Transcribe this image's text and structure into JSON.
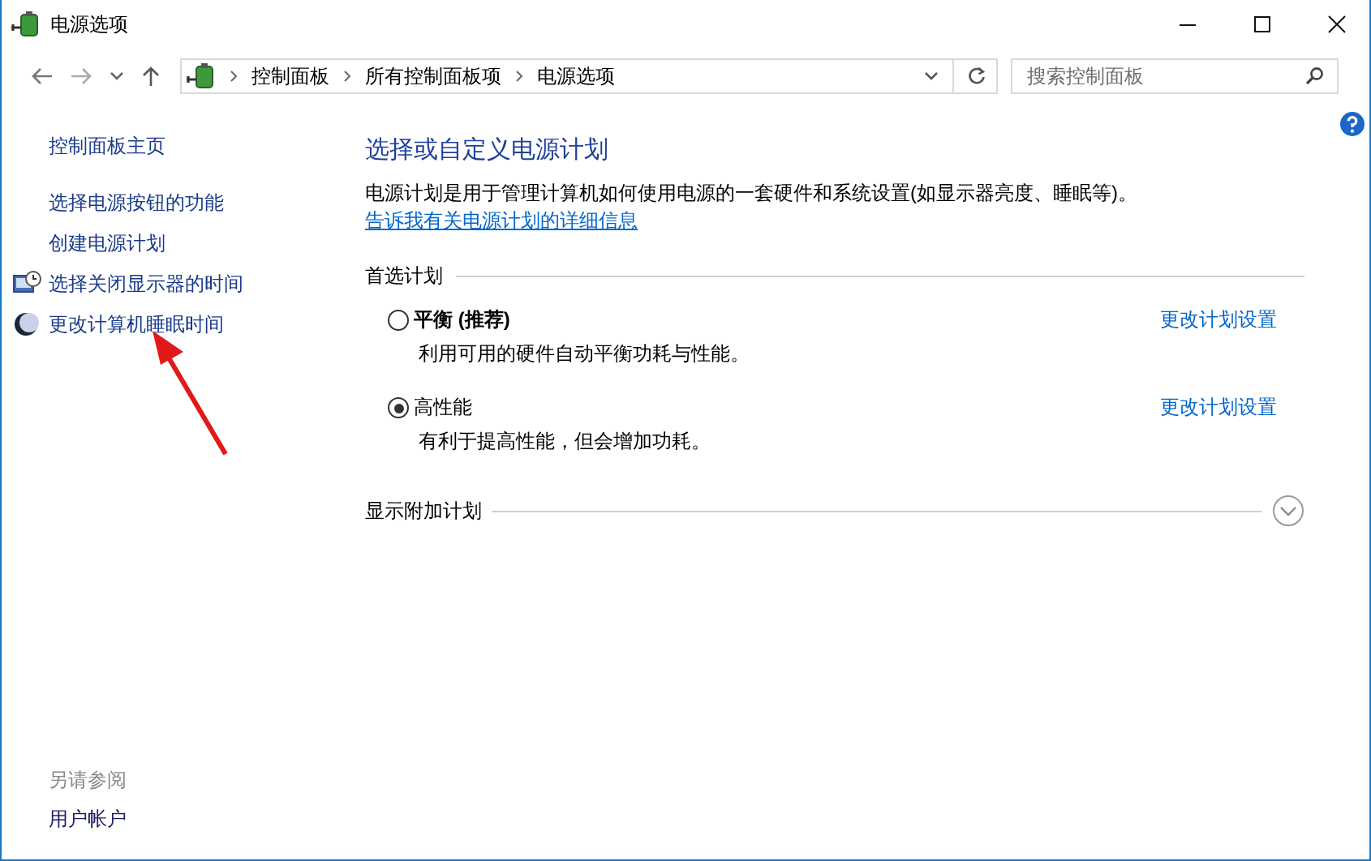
{
  "window": {
    "title": "电源选项"
  },
  "address_bar": {
    "breadcrumbs": [
      "控制面板",
      "所有控制面板项",
      "电源选项"
    ]
  },
  "search": {
    "placeholder": "搜索控制面板"
  },
  "sidebar": {
    "home": "控制面板主页",
    "items": [
      {
        "label": "选择电源按钮的功能"
      },
      {
        "label": "创建电源计划"
      },
      {
        "label": "选择关闭显示器的时间",
        "kind": "monitor"
      },
      {
        "label": "更改计算机睡眠时间",
        "kind": "moon"
      }
    ],
    "see_also": {
      "title": "另请参阅",
      "links": [
        "用户帐户"
      ]
    }
  },
  "content": {
    "title": "选择或自定义电源计划",
    "description": "电源计划是用于管理计算机如何使用电源的一套硬件和系统设置(如显示器亮度、睡眠等)。",
    "help_link": "告诉我有关电源计划的详细信息",
    "section": "首选计划",
    "plans": [
      {
        "name": "平衡 (推荐)",
        "recommended": true,
        "description": "利用可用的硬件自动平衡功耗与性能。",
        "link": "更改计划设置",
        "selected": false
      },
      {
        "name": "高性能",
        "recommended": false,
        "description": "有利于提高性能，但会增加功耗。",
        "link": "更改计划设置",
        "selected": true
      }
    ],
    "more": {
      "label": "显示附加计划",
      "expanded": false
    }
  }
}
